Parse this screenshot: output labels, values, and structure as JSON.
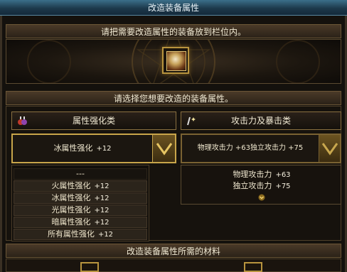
{
  "window": {
    "title": "改造装备属性"
  },
  "slot_panel": {
    "instruction": "请把需要改造属性的装备放到栏位内。"
  },
  "attribute_panel": {
    "instruction": "请选择您想要改造的装备属性。"
  },
  "left": {
    "category_label": "属性强化类",
    "selected_name": "冰属性强化",
    "selected_value": "+12",
    "options": [
      {
        "name": "---",
        "value": ""
      },
      {
        "name": "火属性强化",
        "value": "+12"
      },
      {
        "name": "冰属性强化",
        "value": "+12"
      },
      {
        "name": "光属性强化",
        "value": "+12"
      },
      {
        "name": "暗属性强化",
        "value": "+12"
      },
      {
        "name": "所有属性强化",
        "value": "+12"
      }
    ]
  },
  "right": {
    "category_label": "攻击力及暴击类",
    "selected_text": "物理攻击力 +63独立攻击力 +75",
    "stat1_name": "物理攻击力",
    "stat1_value": "+63",
    "stat2_name": "独立攻击力",
    "stat2_value": "+75"
  },
  "materials": {
    "header": "改造装备属性所需的材料"
  },
  "colors": {
    "accent_gold": "#c8a54a",
    "title_blue": "#1d3a4c"
  },
  "icons": [
    "potion-icon",
    "sword-spark-icon",
    "chevron-down-icon",
    "small-gold-chevron-icon",
    "equipment-item-icon"
  ]
}
